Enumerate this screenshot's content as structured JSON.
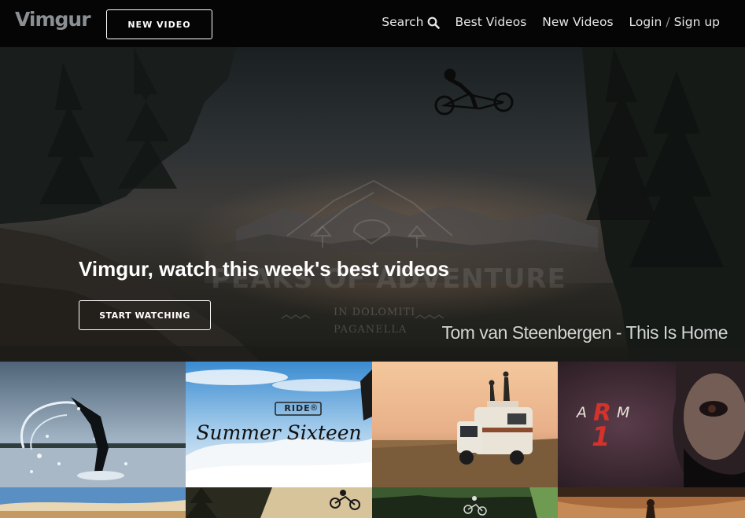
{
  "header": {
    "logo": "Vimgur",
    "new_video_label": "NEW VIDEO",
    "nav": {
      "search_label": "Search",
      "best_videos_label": "Best Videos",
      "new_videos_label": "New Videos",
      "login_label": "Login",
      "separator": "/",
      "signup_label": "Sign up"
    }
  },
  "hero": {
    "title": "Vimgur, watch this week's best videos",
    "start_watching_label": "START WATCHING",
    "caption": "Tom van Steenbergen - This Is Home",
    "watermark_title": "PEAKS OF ADVENTURE",
    "watermark_line1": "IN DOLOMITI",
    "watermark_line2": "PAGANELLA"
  },
  "thumbnails": {
    "ride_badge": "RIDE",
    "ride_mark": "®",
    "summer_title": "Summer Sixteen",
    "arm_left": "A",
    "arm_r": "R",
    "arm_right": "M",
    "arm_number": "1"
  },
  "colors": {
    "header_bg": "#050505",
    "logo": "#8a8f94",
    "text": "#ffffff"
  },
  "icons": {
    "search": "search-icon"
  }
}
